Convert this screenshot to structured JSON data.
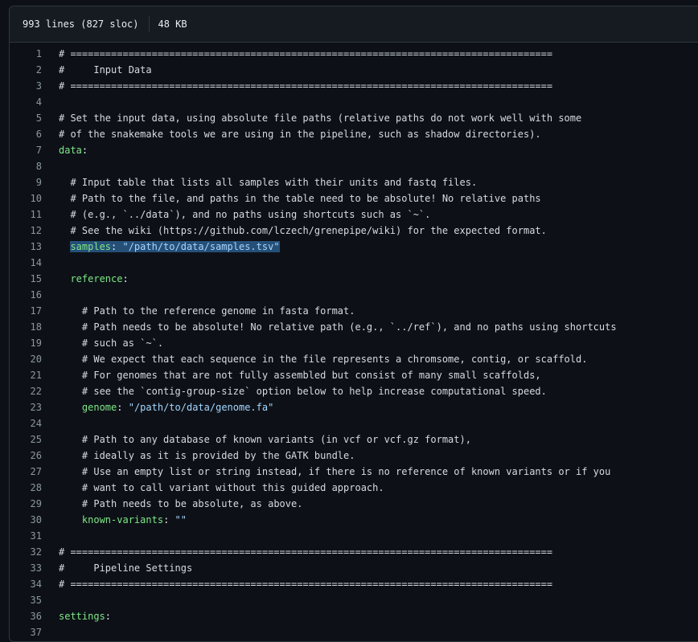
{
  "file_info": {
    "lines": "993 lines (827 sloc)",
    "size": "48 KB"
  },
  "code_lines": [
    {
      "n": "1",
      "indent": "",
      "comment": "# ==================================================================================="
    },
    {
      "n": "2",
      "indent": "",
      "comment": "#     Input Data"
    },
    {
      "n": "3",
      "indent": "",
      "comment": "# ==================================================================================="
    },
    {
      "n": "4",
      "indent": "",
      "comment": ""
    },
    {
      "n": "5",
      "indent": "",
      "comment": "# Set the input data, using absolute file paths (relative paths do not work well with some"
    },
    {
      "n": "6",
      "indent": "",
      "comment": "# of the snakemake tools we are using in the pipeline, such as shadow directories)."
    },
    {
      "n": "7",
      "indent": "",
      "key": "data",
      "colon": ":"
    },
    {
      "n": "8",
      "indent": "",
      "comment": ""
    },
    {
      "n": "9",
      "indent": "  ",
      "comment": "# Input table that lists all samples with their units and fastq files."
    },
    {
      "n": "10",
      "indent": "  ",
      "comment": "# Path to the file, and paths in the table need to be absolute! No relative paths"
    },
    {
      "n": "11",
      "indent": "  ",
      "comment": "# (e.g., `../data`), and no paths using shortcuts such as `~`."
    },
    {
      "n": "12",
      "indent": "  ",
      "comment": "# See the wiki (https://github.com/lczech/grenepipe/wiki) for the expected format."
    },
    {
      "n": "13",
      "indent": "  ",
      "key": "samples",
      "colon": ": ",
      "value": "\"/path/to/data/samples.tsv\"",
      "highlight": true
    },
    {
      "n": "14",
      "indent": "",
      "comment": ""
    },
    {
      "n": "15",
      "indent": "  ",
      "key": "reference",
      "colon": ":"
    },
    {
      "n": "16",
      "indent": "",
      "comment": ""
    },
    {
      "n": "17",
      "indent": "    ",
      "comment": "# Path to the reference genome in fasta format."
    },
    {
      "n": "18",
      "indent": "    ",
      "comment": "# Path needs to be absolute! No relative path (e.g., `../ref`), and no paths using shortcuts"
    },
    {
      "n": "19",
      "indent": "    ",
      "comment": "# such as `~`."
    },
    {
      "n": "20",
      "indent": "    ",
      "comment": "# We expect that each sequence in the file represents a chromsome, contig, or scaffold."
    },
    {
      "n": "21",
      "indent": "    ",
      "comment": "# For genomes that are not fully assembled but consist of many small scaffolds,"
    },
    {
      "n": "22",
      "indent": "    ",
      "comment": "# see the `contig-group-size` option below to help increase computational speed."
    },
    {
      "n": "23",
      "indent": "    ",
      "key": "genome",
      "colon": ": ",
      "value": "\"/path/to/data/genome.fa\""
    },
    {
      "n": "24",
      "indent": "",
      "comment": ""
    },
    {
      "n": "25",
      "indent": "    ",
      "comment": "# Path to any database of known variants (in vcf or vcf.gz format),"
    },
    {
      "n": "26",
      "indent": "    ",
      "comment": "# ideally as it is provided by the GATK bundle."
    },
    {
      "n": "27",
      "indent": "    ",
      "comment": "# Use an empty list or string instead, if there is no reference of known variants or if you"
    },
    {
      "n": "28",
      "indent": "    ",
      "comment": "# want to call variant without this guided approach."
    },
    {
      "n": "29",
      "indent": "    ",
      "comment": "# Path needs to be absolute, as above."
    },
    {
      "n": "30",
      "indent": "    ",
      "key": "known-variants",
      "colon": ": ",
      "value": "\"\""
    },
    {
      "n": "31",
      "indent": "",
      "comment": ""
    },
    {
      "n": "32",
      "indent": "",
      "comment": "# ==================================================================================="
    },
    {
      "n": "33",
      "indent": "",
      "comment": "#     Pipeline Settings"
    },
    {
      "n": "34",
      "indent": "",
      "comment": "# ==================================================================================="
    },
    {
      "n": "35",
      "indent": "",
      "comment": ""
    },
    {
      "n": "36",
      "indent": "",
      "key": "settings",
      "colon": ":"
    },
    {
      "n": "37",
      "indent": "",
      "comment": ""
    }
  ]
}
